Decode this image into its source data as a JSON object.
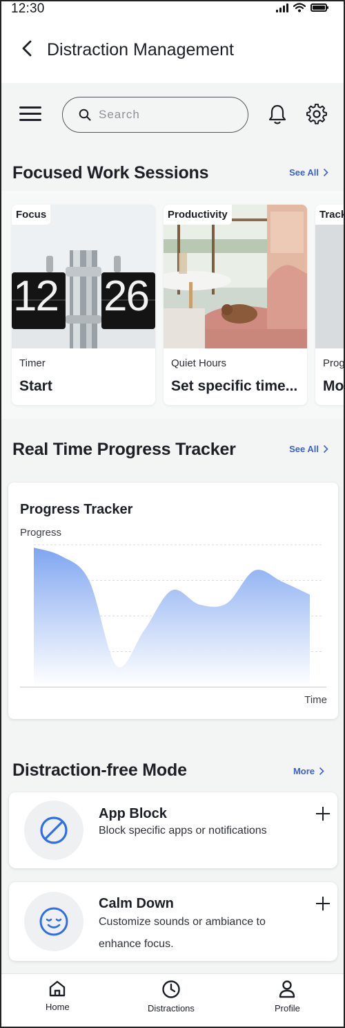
{
  "status_bar": {
    "time": "12:30"
  },
  "header": {
    "title": "Distraction Management"
  },
  "search": {
    "placeholder": "Search"
  },
  "sections": {
    "focused": {
      "title": "Focused Work Sessions",
      "action": "See All"
    },
    "tracker": {
      "title": "Real Time Progress Tracker",
      "action": "See All"
    },
    "dfm": {
      "title": "Distraction-free Mode",
      "action": "More"
    }
  },
  "cards": [
    {
      "tag": "Focus",
      "sub": "Timer",
      "main": "Start",
      "clock_left": "12",
      "clock_right": "26"
    },
    {
      "tag": "Productivity",
      "sub": "Quiet Hours",
      "main": "Set specific time..."
    },
    {
      "tag": "Track",
      "sub": "Prog",
      "main": "Mo"
    }
  ],
  "progress_tracker": {
    "title": "Progress Tracker",
    "y_label": "Progress",
    "x_label": "Time"
  },
  "chart_data": {
    "type": "area",
    "title": "Progress Tracker",
    "xlabel": "Time",
    "ylabel": "Progress",
    "x": [
      0,
      1,
      2,
      3,
      4,
      5,
      6,
      7,
      8,
      9,
      10
    ],
    "values": [
      0.98,
      0.92,
      0.75,
      0.15,
      0.4,
      0.68,
      0.58,
      0.59,
      0.82,
      0.74,
      0.65
    ],
    "ylim": [
      0,
      1
    ],
    "grid": "horizontal dotted",
    "fill_color": "#7fa5f0"
  },
  "dfm_items": [
    {
      "name": "App Block",
      "desc": "Block specific apps or notifications",
      "icon": "block-icon"
    },
    {
      "name": "Calm Down",
      "desc": "Customize sounds or ambiance to enhance focus.",
      "icon": "smile-icon"
    }
  ],
  "nav": [
    {
      "label": "Home",
      "icon": "home-icon"
    },
    {
      "label": "Distractions",
      "icon": "clock-icon"
    },
    {
      "label": "Profile",
      "icon": "profile-icon"
    }
  ],
  "colors": {
    "accent": "#3a62cc",
    "icon_blue": "#2f6ee6"
  }
}
